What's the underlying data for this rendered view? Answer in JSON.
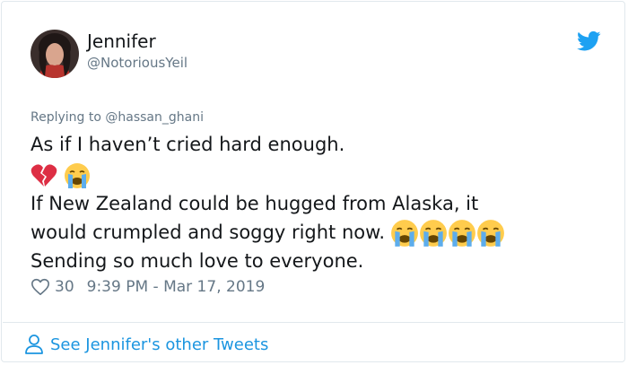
{
  "tweet": {
    "author": {
      "name": "Jennifer",
      "handle": "@NotoriousYeil"
    },
    "replying_prefix": "Replying to ",
    "replying_to": "@hassan_ghani",
    "lines": [
      "As if I haven’t cried hard enough.",
      "If New Zealand could be hugged from Alaska, it",
      "would crumpled and soggy right now.",
      "Sending so much love to everyone."
    ],
    "emoji_line_icons": [
      "broken-heart-icon",
      "crying-face-icon"
    ],
    "inline_emojis": [
      "crying-face-icon",
      "crying-face-icon",
      "crying-face-icon",
      "crying-face-icon"
    ],
    "likes": "30",
    "timestamp": "9:39 PM - Mar 17, 2019"
  },
  "footer": {
    "link_label": "See Jennifer's other Tweets"
  },
  "colors": {
    "text": "#14171a",
    "muted": "#657786",
    "link": "#1b95e0",
    "twitter_blue": "#1da1f2",
    "border": "#e1e8ed"
  }
}
